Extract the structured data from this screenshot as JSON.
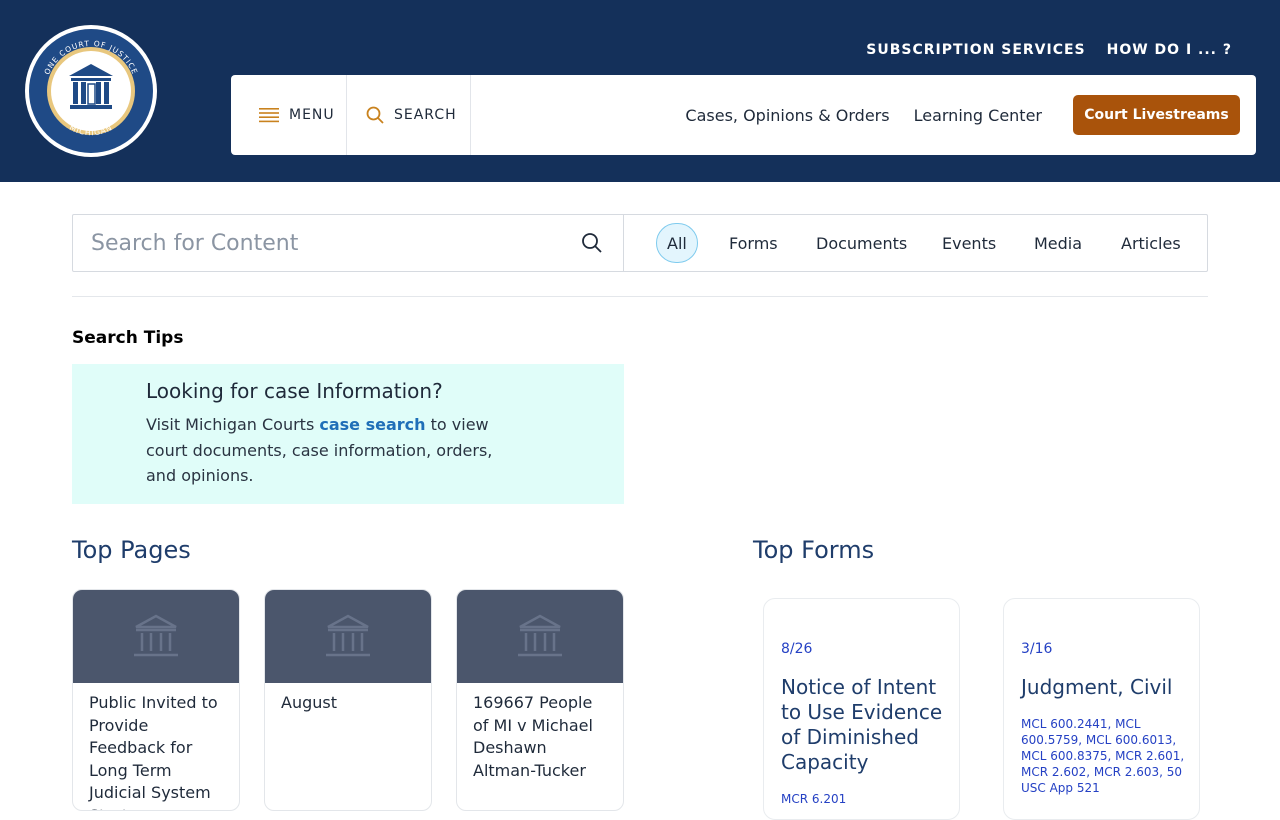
{
  "brand": {
    "seal_text_top": "ONE COURT OF JUSTICE",
    "seal_text_bottom": "MICHIGAN"
  },
  "utility_nav": [
    "SUBSCRIPTION SERVICES",
    "HOW DO I ... ?"
  ],
  "main_nav": {
    "menu_label": "MENU",
    "search_label": "SEARCH",
    "links": [
      "Cases, Opinions & Orders",
      "Learning Center"
    ],
    "livestream_label": "Court Livestreams"
  },
  "search": {
    "placeholder": "Search for Content",
    "filters": [
      "All",
      "Forms",
      "Documents",
      "Events",
      "Media",
      "Articles"
    ],
    "active_filter": "All"
  },
  "tips": {
    "title": "Search Tips",
    "heading": "Looking for case Information?",
    "body_before": "Visit Michigan Courts ",
    "body_link": "case search",
    "body_after": " to view court documents, case information, orders, and opinions."
  },
  "top_pages": {
    "title": "Top Pages",
    "items": [
      "Public Invited to Provide Feedback for Long Term Judicial System Strategy",
      "August",
      "169667 People of MI v Michael Deshawn Altman-Tucker"
    ]
  },
  "top_forms": {
    "title": "Top Forms",
    "items": [
      {
        "date": "8/26",
        "title": "Notice of Intent to Use Evidence of Diminished Capacity",
        "refs": "MCR 6.201"
      },
      {
        "date": "3/16",
        "title": "Judgment, Civil",
        "refs": "MCL 600.2441, MCL 600.5759, MCL 600.6013, MCL 600.8375, MCR 2.601, MCR 2.602, MCR 2.603, 50 USC App 521"
      }
    ]
  },
  "colors": {
    "header_bg": "#14305a",
    "accent_orange": "#a9530b",
    "tip_bg": "#e0fdf9",
    "link_blue": "#1f6fb8"
  }
}
